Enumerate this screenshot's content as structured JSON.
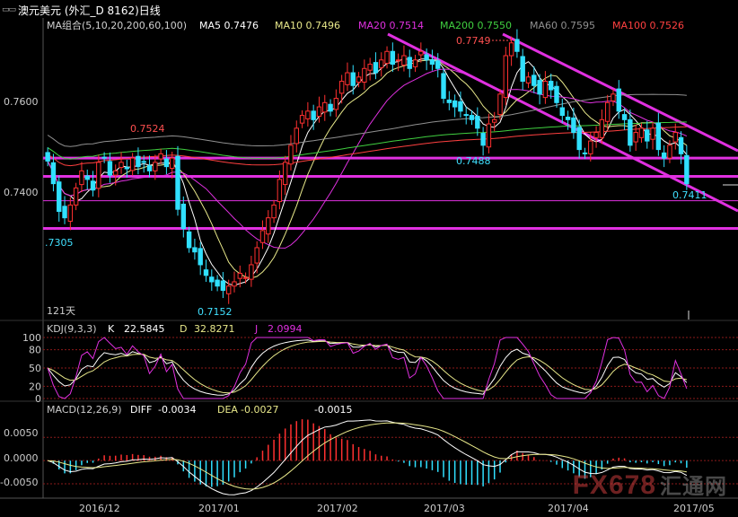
{
  "title": "澳元美元 (外汇_D 8162)日线",
  "main": {
    "legend_label": "MA组合(5,10,20,200,60,100)",
    "ma": [
      {
        "name": "MA5",
        "value": "0.7476",
        "color": "#ffffff"
      },
      {
        "name": "MA10",
        "value": "0.7496",
        "color": "#e8e88a"
      },
      {
        "name": "MA20",
        "value": "0.7514",
        "color": "#e030e0"
      },
      {
        "name": "MA200",
        "value": "0.7550",
        "color": "#40d040"
      },
      {
        "name": "MA60",
        "value": "0.7595",
        "color": "#909090"
      },
      {
        "name": "MA100",
        "value": "0.7526",
        "color": "#ff4040"
      }
    ],
    "y_ticks": [
      "0.7600",
      "0.7400"
    ],
    "annotations": [
      {
        "text": "0.7749",
        "color": "#ff5050"
      },
      {
        "text": "0.7524",
        "color": "#ff5050"
      },
      {
        "text": "0.7488",
        "color": "#40e0ff"
      },
      {
        "text": "0.7411",
        "color": "#40e0ff"
      },
      {
        "text": ".7305",
        "color": "#40e0ff"
      },
      {
        "text": "0.7152",
        "color": "#40e0ff"
      }
    ],
    "day_count": "121天"
  },
  "kdj": {
    "label": "KDJ(9,3,3)",
    "k_label": "K",
    "k_value": "22.5845",
    "d_label": "D",
    "d_value": "32.8271",
    "j_label": "J",
    "j_value": "2.0994",
    "ticks": [
      "100",
      "80",
      "50",
      "20",
      "0"
    ]
  },
  "macd": {
    "label": "MACD(12,26,9)",
    "diff_label": "DIFF",
    "diff_value": "-0.0034",
    "dea_label": "DEA",
    "dea_value": "-0.0027",
    "macd_value": "-0.0015",
    "ticks": [
      "0.0050",
      "0.0000",
      "-0.0050"
    ]
  },
  "x_labels": [
    "2016/12",
    "2017/01",
    "2017/02",
    "2017/03",
    "2017/04",
    "2017/05"
  ],
  "watermark": {
    "brand": "FX678",
    "cn": "汇通网"
  },
  "chart_data": {
    "type": "candlestick",
    "title": "澳元美元 (外汇_D 8162)日线",
    "y_range": [
      0.71,
      0.779
    ],
    "key_levels": [
      {
        "value": 0.7749,
        "label": "0.7749"
      },
      {
        "value": 0.7524,
        "label": "0.7524"
      },
      {
        "value": 0.7488,
        "label": "0.7488"
      },
      {
        "value": 0.7411,
        "label": "0.7411"
      },
      {
        "value": 0.7305,
        "label": ".7305"
      },
      {
        "value": 0.7152,
        "label": "0.7152"
      }
    ],
    "horizontal_lines": [
      0.747,
      0.7427,
      0.737,
      0.7305
    ],
    "close": [
      0.7463,
      0.741,
      0.7345,
      0.733,
      0.736,
      0.74,
      0.744,
      0.742,
      0.7395,
      0.746,
      0.747,
      0.743,
      0.744,
      0.746,
      0.7445,
      0.747,
      0.745,
      0.746,
      0.744,
      0.746,
      0.748,
      0.745,
      0.747,
      0.735,
      0.7305,
      0.726,
      0.725,
      0.722,
      0.7195,
      0.718,
      0.717,
      0.716,
      0.717,
      0.718,
      0.72,
      0.719,
      0.722,
      0.726,
      0.73,
      0.733,
      0.736,
      0.742,
      0.746,
      0.75,
      0.754,
      0.757,
      0.758,
      0.756,
      0.759,
      0.76,
      0.758,
      0.761,
      0.765,
      0.767,
      0.764,
      0.766,
      0.768,
      0.769,
      0.767,
      0.77,
      0.772,
      0.769,
      0.77,
      0.771,
      0.768,
      0.77,
      0.772,
      0.77,
      0.769,
      0.768,
      0.761,
      0.76,
      0.759,
      0.758,
      0.757,
      0.756,
      0.754,
      0.75,
      0.755,
      0.756,
      0.762,
      0.771,
      0.774,
      0.772,
      0.765,
      0.766,
      0.764,
      0.762,
      0.765,
      0.763,
      0.76,
      0.757,
      0.756,
      0.753,
      0.749,
      0.748,
      0.751,
      0.753,
      0.756,
      0.76,
      0.762,
      0.758,
      0.756,
      0.75,
      0.753,
      0.754,
      0.751,
      0.754,
      0.749,
      0.747,
      0.75,
      0.753,
      0.748,
      0.741
    ],
    "ma": {
      "MA5": 0.7476,
      "MA10": 0.7496,
      "MA20": 0.7514,
      "MA200": 0.755,
      "MA60": 0.7595,
      "MA100": 0.7526
    },
    "kdj": {
      "K": 22.5845,
      "D": 32.8271,
      "J": 2.0994,
      "range": [
        0,
        100
      ]
    },
    "macd": {
      "DIFF": -0.0034,
      "DEA": -0.0027,
      "MACD": -0.0015,
      "range": [
        -0.0075,
        0.0095
      ]
    },
    "x_labels": [
      "2016/12",
      "2017/01",
      "2017/02",
      "2017/03",
      "2017/04",
      "2017/05"
    ]
  }
}
